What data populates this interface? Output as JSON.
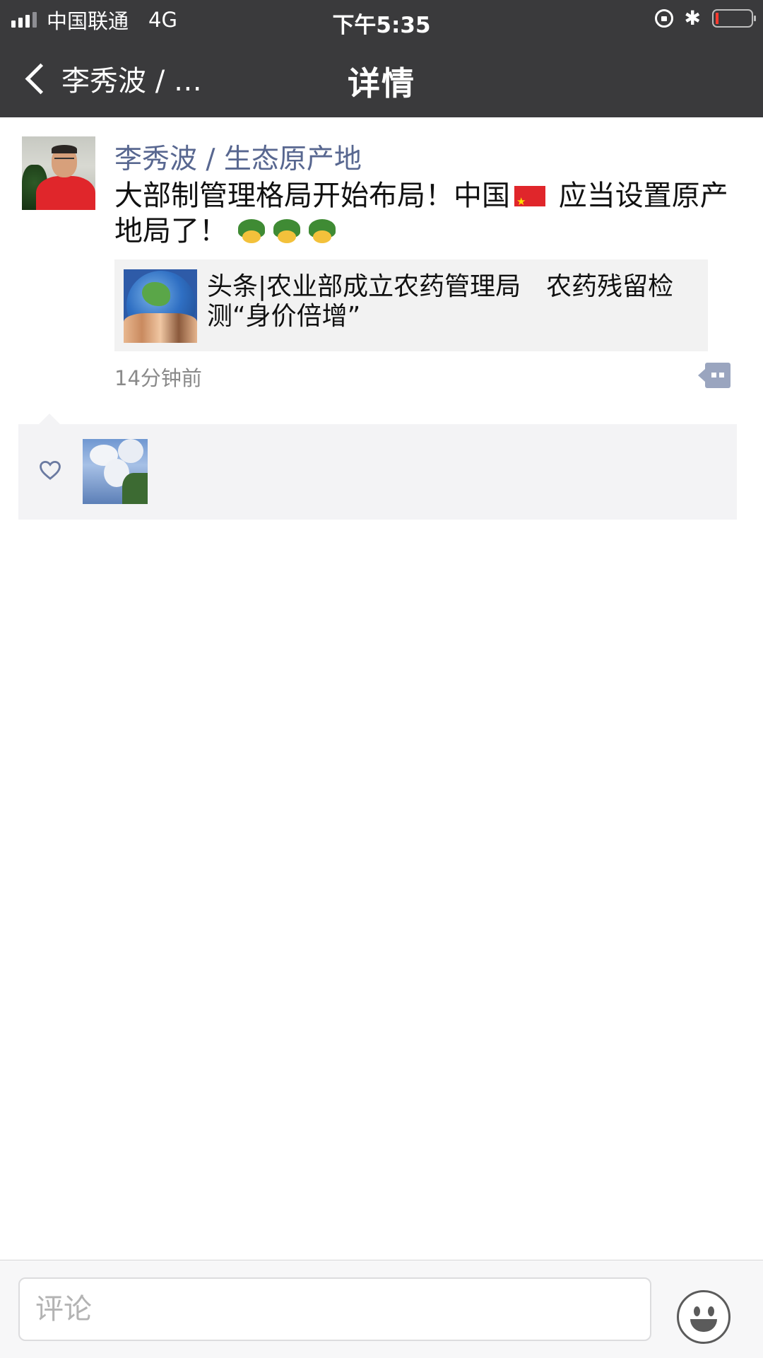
{
  "status_bar": {
    "carrier": "中国联通",
    "network": "4G",
    "time": "下午5:35"
  },
  "nav": {
    "back_label": "李秀波 / …",
    "title": "详情"
  },
  "post": {
    "author": "李秀波 / 生态原产地",
    "text_part1": "大部制管理格局开始布局！中国",
    "text_part2": " 应当设置原产地局了！ ",
    "flag_icon": "china-flag-emoji",
    "emoji_icons": [
      "turtle-emoji",
      "turtle-emoji",
      "turtle-emoji"
    ],
    "link": {
      "title": "头条|农业部成立农药管理局　农药残留检测“身价倍增”",
      "thumb_icon": "globe-hands-image"
    },
    "time_ago": "14分钟前"
  },
  "likes": {
    "icon": "heart-icon",
    "liker_avatar": "sky-clouds-avatar"
  },
  "comment_bar": {
    "placeholder": "评论",
    "emoji_icon": "smiley-face-icon"
  },
  "colors": {
    "bar_bg": "#3a3a3c",
    "author_link": "#586790",
    "likes_bg": "#f3f3f5",
    "link_card_bg": "#f2f2f2"
  }
}
